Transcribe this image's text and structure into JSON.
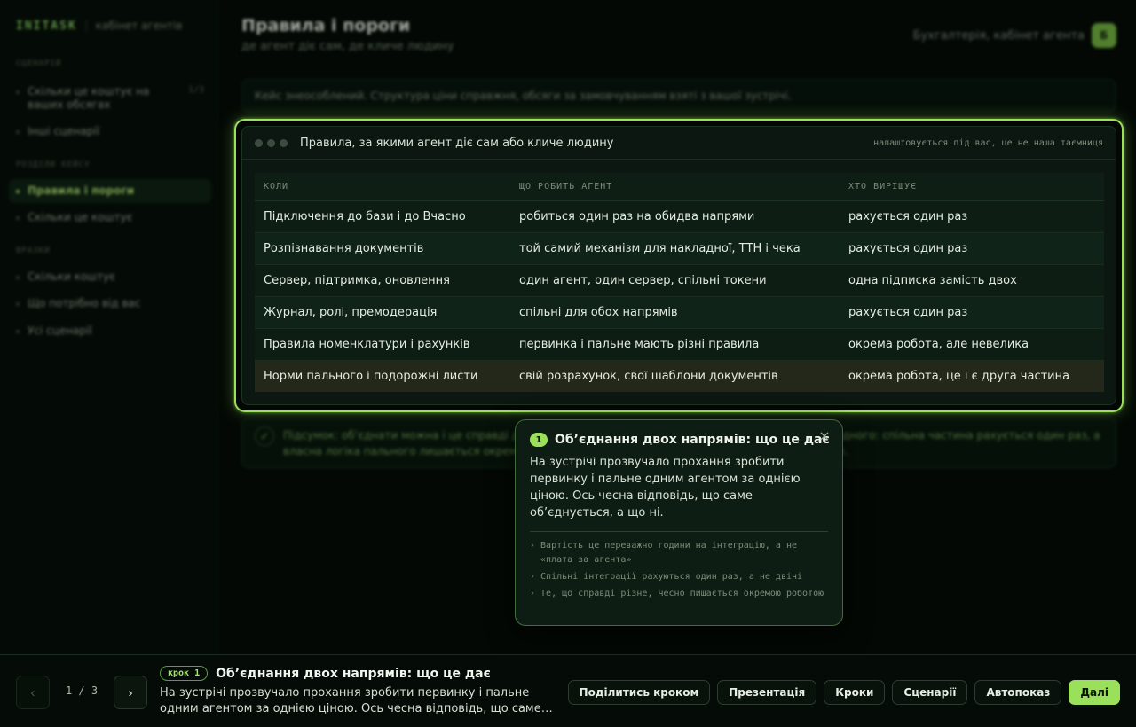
{
  "app": {
    "logo": "INITASK",
    "subtitle": "кабінет агентів"
  },
  "sidebar": {
    "section_scenario": "СЦЕНАРІЙ",
    "scenario_items": [
      {
        "label": "Скільки це коштує на ваших обсягах",
        "count": "1/3"
      },
      {
        "label": "Інші сценарії"
      }
    ],
    "section_sections": "РОЗДІЛИ КЕЙСУ",
    "section_items": [
      {
        "label": "Правила і пороги",
        "active": true
      },
      {
        "label": "Скільки це коштує"
      }
    ],
    "section_docs": "ВРАЗКИ",
    "doc_items": [
      {
        "label": "Скільки коштує"
      },
      {
        "label": "Що потрібно від вас"
      },
      {
        "label": "Усі сценарії"
      }
    ]
  },
  "header": {
    "title": "Правила і пороги",
    "subtitle": "де агент діє сам, де кличе людину",
    "account": "Бухгалтерія, кабінет агента",
    "avatar": "Б"
  },
  "notice": "Кейс знеособлений. Структура ціни справжня, обсяги за замовчуванням взяті з вашої зустрічі.",
  "panel": {
    "title": "Правила, за якими агент діє сам або кличе людину",
    "meta": "налаштовується під вас, це не наша таємниця",
    "columns": [
      "КОЛИ",
      "ЩО РОБИТЬ АГЕНТ",
      "ХТО ВИРІШУЄ"
    ],
    "rows": [
      [
        "Підключення до бази і до Вчасно",
        "робиться один раз на обидва напрями",
        "рахується один раз"
      ],
      [
        "Розпізнавання документів",
        "той самий механізм для накладної, ТТН і чека",
        "рахується один раз"
      ],
      [
        "Сервер, підтримка, оновлення",
        "один агент, один сервер, спільні токени",
        "одна підписка замість двох"
      ],
      [
        "Журнал, ролі, премодерація",
        "спільні для обох напрямів",
        "рахується один раз"
      ],
      [
        "Правила номенклатури і рахунків",
        "первинка і пальне мають різні правила",
        "окрема робота, але невелика"
      ],
      [
        "Норми пального і подорожні листи",
        "свій розрахунок, свої шаблони документів",
        "окрема робота, це і є друга частина"
      ]
    ],
    "highlight_row": 5
  },
  "summary": {
    "check": "✓",
    "text": "Підсумок: об’єднати можна і це справді дешевше, ніж два окремі агенти, але не вдвічі дешевше одного: спільна частина рахується один раз, а власна логіка пального лишається окремою роботою, яку ми чесно показуємо у вартості та кроках."
  },
  "popover": {
    "badge": "1",
    "title": "Об’єднання двох напрямів: що це дає",
    "close": "×",
    "body": "На зустрічі прозвучало прохання зробити первинку і пальне одним агентом за однією ціною. Ось чесна відповідь, що саме об’єднується, а що ні.",
    "points": [
      "Вартість це переважно години на інтеграцію, а не «плата за агента»",
      "Спільні інтеграції рахуються один раз, а не двічі",
      "Те, що справді різне, чесно пишається окремою роботою"
    ]
  },
  "bottombar": {
    "prev": "‹",
    "next": "›",
    "counter": "1 / 3",
    "step_chip": "крок 1",
    "step_title": "Об’єднання двох напрямів: що це дає",
    "step_desc": "На зустрічі прозвучало прохання зробити первинку і пальне одним агентом за однією ціною. Ось чесна відповідь, що саме…",
    "actions": {
      "share": "Поділитись кроком",
      "presentation": "Презентація",
      "steps": "Кроки",
      "scenarios": "Сценарії",
      "autoplay": "Автопоказ",
      "next": "Далі"
    }
  },
  "colors": {
    "accent": "#9be05a",
    "background": "#030804",
    "panel": "#0b1710",
    "highlight_row": "#24281a"
  }
}
